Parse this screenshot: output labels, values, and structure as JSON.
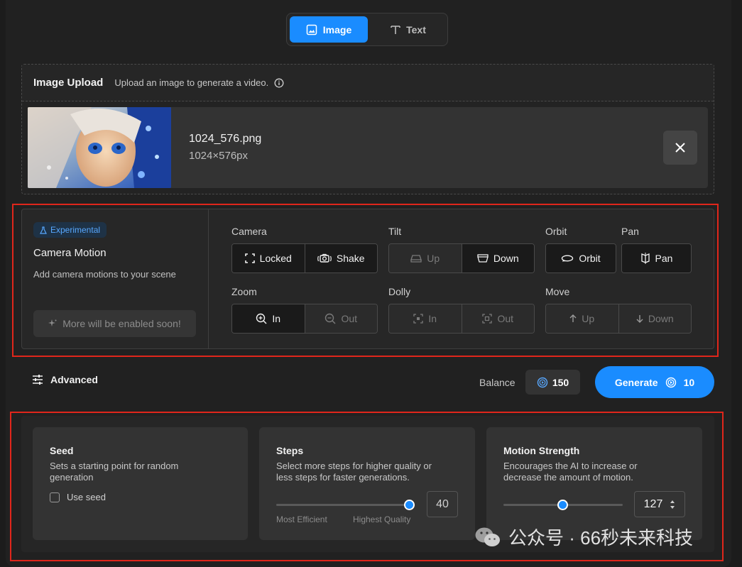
{
  "mode_toggle": {
    "image_label": "Image",
    "text_label": "Text",
    "active": "Image"
  },
  "upload": {
    "title": "Image Upload",
    "subtitle": "Upload an image to generate a video.",
    "file_name": "1024_576.png",
    "file_dims": "1024×576px"
  },
  "camera": {
    "badge": "Experimental",
    "title": "Camera Motion",
    "subtitle": "Add camera motions to your scene",
    "soon_label": "More will be enabled soon!",
    "groups": {
      "camera": {
        "label": "Camera",
        "options": [
          "Locked",
          "Shake"
        ]
      },
      "tilt": {
        "label": "Tilt",
        "options": [
          "Up",
          "Down"
        ]
      },
      "orbit": {
        "label": "Orbit",
        "options": [
          "Orbit"
        ]
      },
      "pan": {
        "label": "Pan",
        "options": [
          "Pan"
        ]
      },
      "zoom": {
        "label": "Zoom",
        "options": [
          "In",
          "Out"
        ]
      },
      "dolly": {
        "label": "Dolly",
        "options": [
          "In",
          "Out"
        ]
      },
      "move": {
        "label": "Move",
        "options": [
          "Up",
          "Down"
        ]
      }
    }
  },
  "actions": {
    "advanced_label": "Advanced",
    "balance_label": "Balance",
    "balance_value": "150",
    "generate_label": "Generate",
    "generate_cost": "10"
  },
  "advanced": {
    "seed": {
      "title": "Seed",
      "desc": "Sets a starting point for random generation",
      "checkbox_label": "Use seed",
      "checked": false
    },
    "steps": {
      "title": "Steps",
      "desc": "Select more steps for higher quality or less steps for faster generations.",
      "value": "40",
      "min_label": "Most Efficient",
      "max_label": "Highest Quality",
      "fraction": 1.0
    },
    "motion": {
      "title": "Motion Strength",
      "desc": "Encourages the AI to increase or decrease the amount of motion.",
      "value": "127",
      "fraction": 0.5
    }
  },
  "watermark": {
    "text": "公众号 · 66秒未来科技"
  },
  "colors": {
    "accent": "#1a8cff",
    "highlight": "#e0261b",
    "experimental": "#58a8ff"
  }
}
